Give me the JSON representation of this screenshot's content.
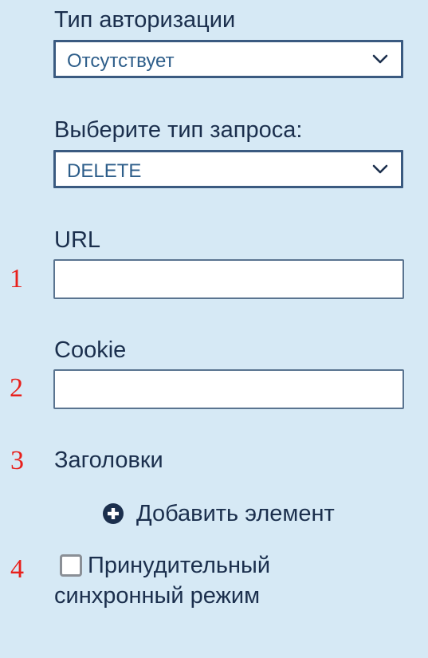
{
  "auth": {
    "label": "Тип авторизации",
    "selected": "Отсутствует"
  },
  "request_type": {
    "label": "Выберите тип запроса:",
    "selected": "DELETE"
  },
  "url": {
    "label": "URL",
    "value": "",
    "marker": "1"
  },
  "cookie": {
    "label": "Cookie",
    "value": "",
    "marker": "2"
  },
  "headers": {
    "label": "Заголовки",
    "marker": "3",
    "add_label": "Добавить элемент"
  },
  "sync_mode": {
    "label_line1": "Принудительный",
    "label_line2": "синхронный режим",
    "checked": false,
    "marker": "4"
  },
  "colors": {
    "background": "#d6e9f5",
    "text": "#1b2f4d",
    "select_border": "#3a5a80",
    "select_text": "#2e5e8a",
    "marker": "#e8201c"
  },
  "icons": {
    "select_chevron": "chevron-down-icon",
    "add": "plus-circle-icon"
  }
}
